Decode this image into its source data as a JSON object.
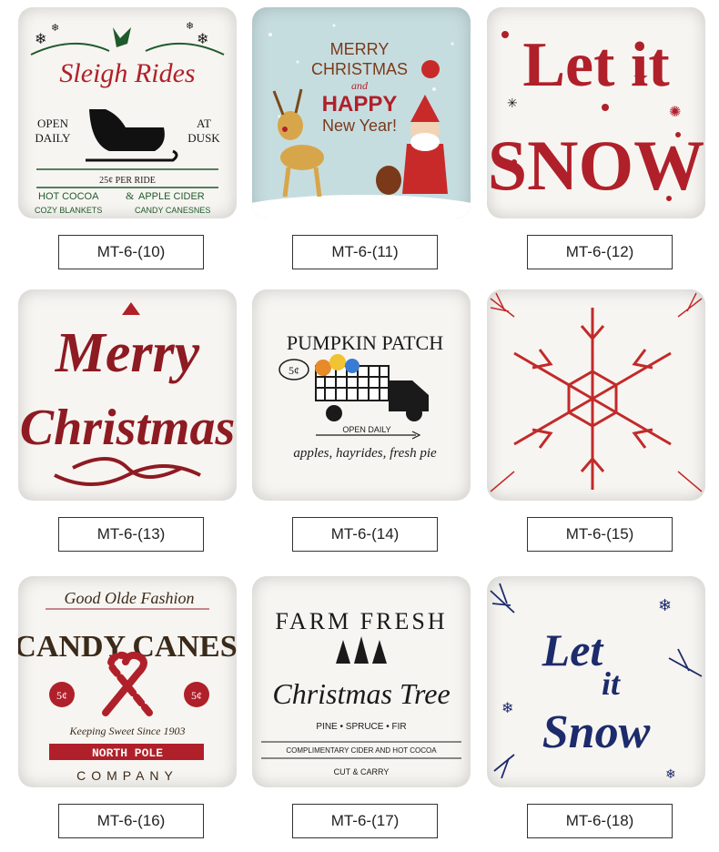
{
  "products": [
    {
      "code": "MT-6-(10)",
      "text": {
        "t1": "Sleigh Rides",
        "t2": "OPEN",
        "t3": "DAILY",
        "t4": "AT",
        "t5": "DUSK",
        "t6": "25¢ PER RIDE",
        "t7": "HOT COCOA",
        "t8": "&",
        "t9": "APPLE CIDER",
        "t10": "COZY BLANKETS",
        "t11": "CANDY CANESNES"
      }
    },
    {
      "code": "MT-6-(11)",
      "text": {
        "t1": "MERRY",
        "t2": "CHRISTMAS",
        "t3": "and",
        "t4": "HAPPY",
        "t5": "New Year!"
      }
    },
    {
      "code": "MT-6-(12)",
      "text": {
        "t1": "Let it",
        "t2": "SNOW"
      }
    },
    {
      "code": "MT-6-(13)",
      "text": {
        "t1": "Merry",
        "t2": "Christmas"
      }
    },
    {
      "code": "MT-6-(14)",
      "text": {
        "t1": "PUMPKIN PATCH",
        "t2": "5¢",
        "t3": "OPEN DAILY",
        "t4": "apples, hayrides, fresh pie"
      }
    },
    {
      "code": "MT-6-(15)",
      "text": {}
    },
    {
      "code": "MT-6-(16)",
      "text": {
        "t1": "Good Olde Fashion",
        "t2": "CANDY CANES",
        "t3": "5¢",
        "t4": "5¢",
        "t5": "Keeping Sweet Since 1903",
        "t6": "NORTH POLE",
        "t7": "COMPANY"
      }
    },
    {
      "code": "MT-6-(17)",
      "text": {
        "t1": "FARM FRESH",
        "t2": "Christmas Tree",
        "t3": "PINE • SPRUCE • FIR",
        "t4": "COMPLIMENTARY CIDER AND HOT COCOA",
        "t5": "CUT & CARRY"
      }
    },
    {
      "code": "MT-6-(18)",
      "text": {
        "t1": "Let",
        "t2": "it",
        "t3": "Snow"
      }
    }
  ],
  "colors": {
    "red": "#b0202a",
    "dark_red": "#8e1a22",
    "green": "#1f5a2c",
    "navy": "#1c2b6b",
    "black": "#1a1a1a",
    "pillow_white": "#f7f5f1",
    "pillow_blue": "#c6dde0"
  }
}
